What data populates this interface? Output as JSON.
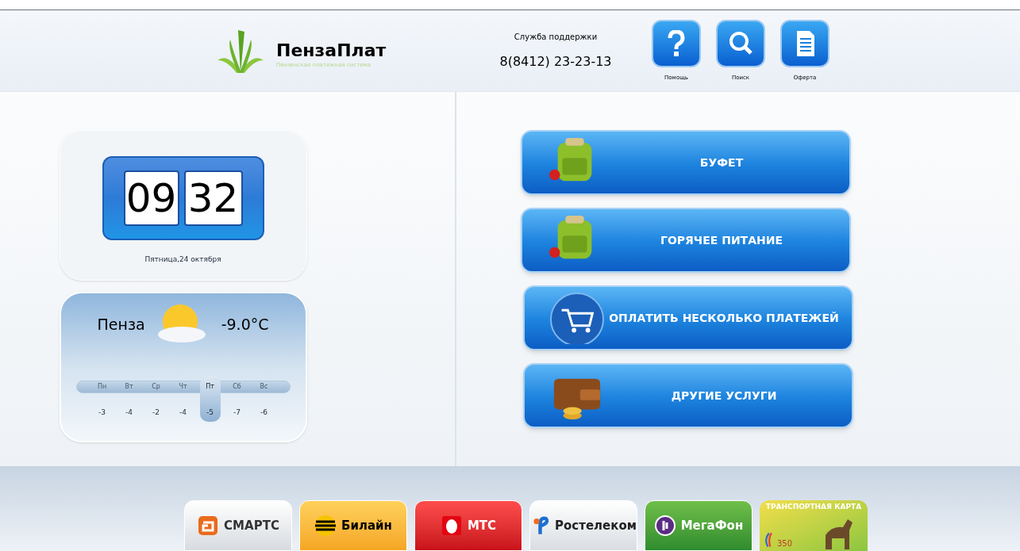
{
  "header": {
    "brand": "ПензаПлат",
    "tagline": "Пензенская платежная система",
    "support_label": "Служба поддержки",
    "support_phone": "8(8412) 23-23-13",
    "actions": [
      {
        "kind": "help",
        "label": "Помощь"
      },
      {
        "kind": "search",
        "label": "Поиск"
      },
      {
        "kind": "offer",
        "label": "Оферта"
      }
    ]
  },
  "clock": {
    "hours": "09",
    "minutes": "32",
    "date": "Пятница,24 октября"
  },
  "weather": {
    "city": "Пенза",
    "temperature": "-9.0°C",
    "forecast": [
      {
        "day": "Пн",
        "temp": "-3",
        "selected": false
      },
      {
        "day": "Вт",
        "temp": "-4",
        "selected": false
      },
      {
        "day": "Ср",
        "temp": "-2",
        "selected": false
      },
      {
        "day": "Чт",
        "temp": "-4",
        "selected": false
      },
      {
        "day": "Пт",
        "temp": "-5",
        "selected": true
      },
      {
        "day": "Сб",
        "temp": "-7",
        "selected": false
      },
      {
        "day": "Вс",
        "temp": "-6",
        "selected": false
      }
    ]
  },
  "services": [
    {
      "kind": "backpack",
      "label": "БУФЕТ"
    },
    {
      "kind": "backpack",
      "label": "ГОРЯЧЕЕ ПИТАНИЕ"
    },
    {
      "kind": "cart",
      "label": "ОПЛАТИТЬ НЕСКОЛЬКО ПЛАТЕЖЕЙ"
    },
    {
      "kind": "wallet",
      "label": "ДРУГИЕ УСЛУГИ"
    }
  ],
  "providers": [
    {
      "kind": "smarts",
      "label": "СМАРТС"
    },
    {
      "kind": "beeline",
      "label": "Билайн"
    },
    {
      "kind": "mts",
      "label": "МТС"
    },
    {
      "kind": "rostelecom",
      "label": "Ростелеком"
    },
    {
      "kind": "megafon",
      "label": "МегаФон"
    },
    {
      "kind": "transport",
      "label": "ТРАНСПОРТНАЯ КАРТА",
      "note": "350"
    }
  ]
}
